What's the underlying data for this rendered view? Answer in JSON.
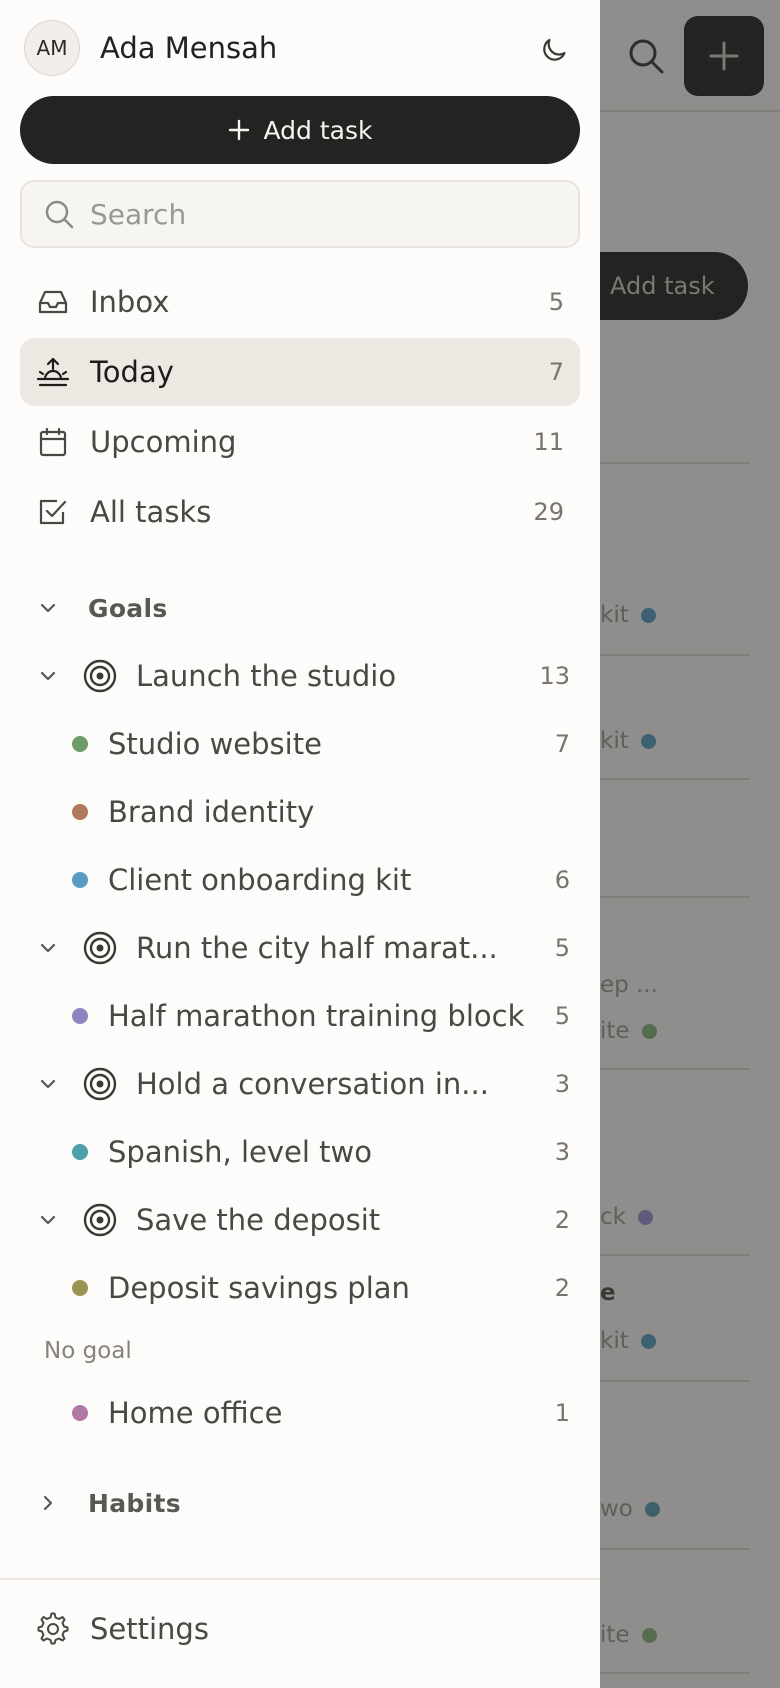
{
  "profile": {
    "initials": "AM",
    "name": "Ada Mensah"
  },
  "add_task_label": "Add task",
  "search": {
    "placeholder": "Search",
    "value": ""
  },
  "nav": [
    {
      "label": "Inbox",
      "count": "5",
      "icon": "inbox-icon"
    },
    {
      "label": "Today",
      "count": "7",
      "icon": "sunrise-icon",
      "active": true
    },
    {
      "label": "Upcoming",
      "count": "11",
      "icon": "calendar-icon"
    },
    {
      "label": "All tasks",
      "count": "29",
      "icon": "checkbox-icon"
    }
  ],
  "goals": {
    "title": "Goals",
    "items": [
      {
        "label": "Launch the studio",
        "count": "13",
        "projects": [
          {
            "label": "Studio website",
            "count": "7",
            "color": "#6f9a6a"
          },
          {
            "label": "Brand identity",
            "count": "",
            "color": "#b07a5e"
          },
          {
            "label": "Client onboarding kit",
            "count": "6",
            "color": "#5a9ac0"
          }
        ]
      },
      {
        "label": "Run the city half marat...",
        "count": "5",
        "projects": [
          {
            "label": "Half marathon training block",
            "count": "5",
            "color": "#8e85c0"
          }
        ]
      },
      {
        "label": "Hold a conversation in...",
        "count": "3",
        "projects": [
          {
            "label": "Spanish, level two",
            "count": "3",
            "color": "#4e9fa6"
          }
        ]
      },
      {
        "label": "Save the deposit",
        "count": "2",
        "projects": [
          {
            "label": "Deposit savings plan",
            "count": "2",
            "color": "#9a9353"
          }
        ]
      }
    ],
    "no_goal_label": "No goal",
    "no_goal_projects": [
      {
        "label": "Home office",
        "count": "1",
        "color": "#b178a6"
      }
    ]
  },
  "habits": {
    "title": "Habits"
  },
  "settings_label": "Settings",
  "background": {
    "add_task_label": "Add task",
    "fragments": [
      {
        "text": "kit",
        "color": "#3f5f72"
      },
      {
        "text": "kit",
        "color": "#3f5f72"
      },
      {
        "text": "ep ...",
        "color": ""
      },
      {
        "text": "ite",
        "color": "#566c4f"
      },
      {
        "text": "ck",
        "color": "#625a7a"
      },
      {
        "text": "e",
        "color": ""
      },
      {
        "text": "kit",
        "color": "#3f5f72"
      },
      {
        "text": "wo",
        "color": "#3f6068"
      },
      {
        "text": "ite",
        "color": "#566c4f"
      }
    ]
  },
  "colors": {
    "accent": "#242321",
    "active_bg": "#ede8e1",
    "drawer_bg": "#fdfcfa",
    "overlay": "#8f8e8c"
  }
}
